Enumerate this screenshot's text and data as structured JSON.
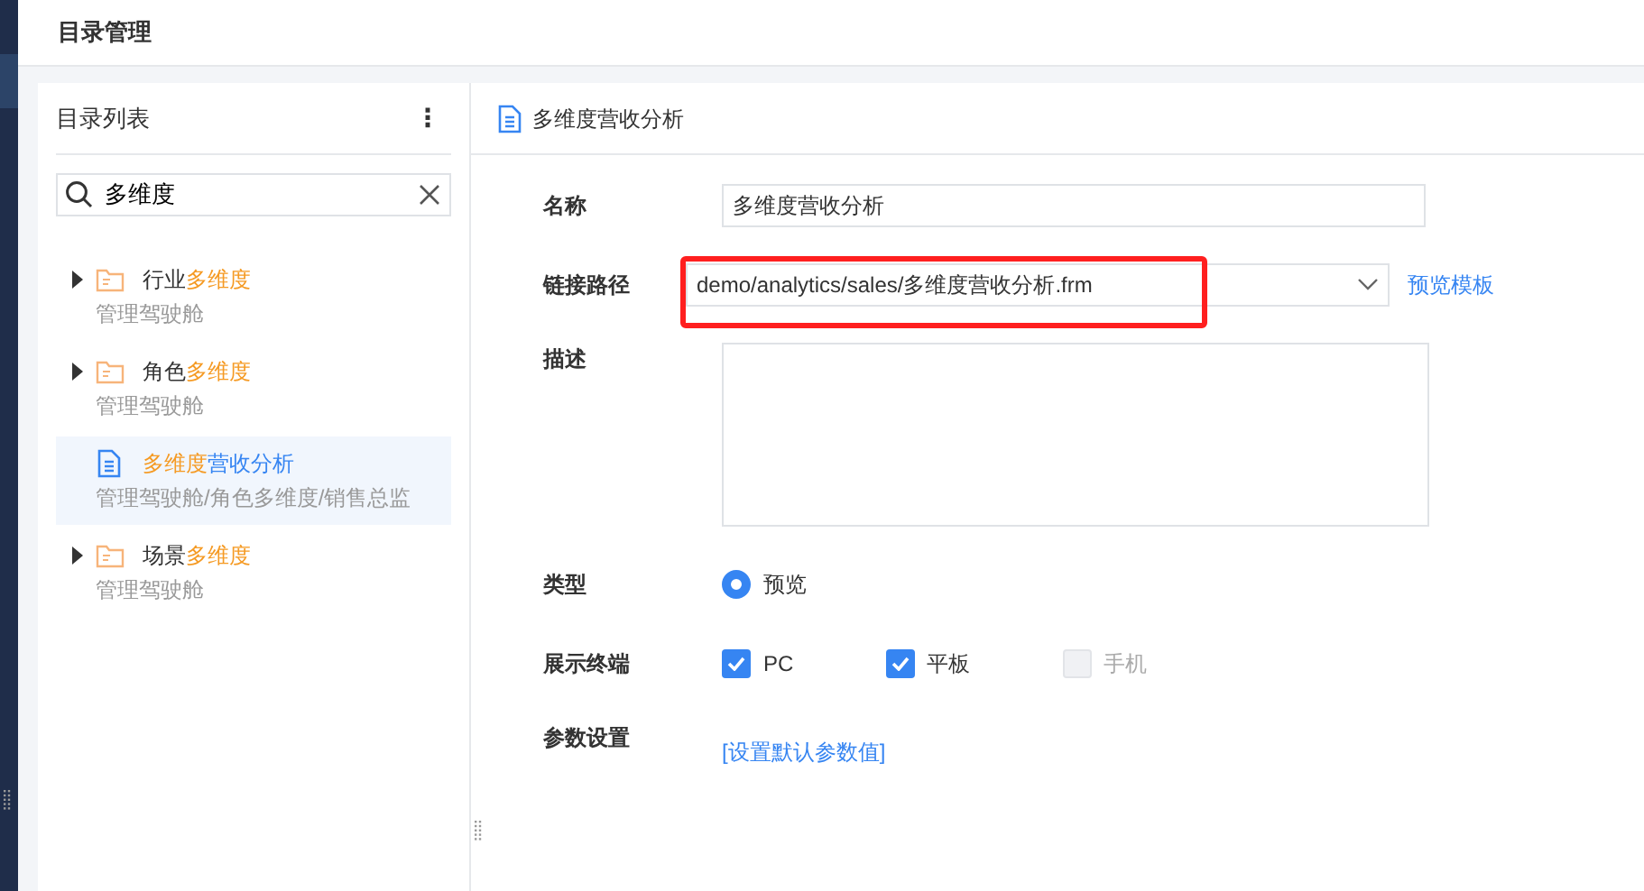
{
  "header": {
    "title": "目录管理"
  },
  "catalog": {
    "title": "目录列表",
    "menu_icon": "⋮",
    "search": {
      "value": "多维度"
    },
    "items": [
      {
        "kind": "folder",
        "expanded": false,
        "selected": false,
        "name": [
          {
            "text": "行业",
            "match": false
          },
          {
            "text": "多维度",
            "match": true
          }
        ],
        "path": "管理驾驶舱"
      },
      {
        "kind": "folder",
        "expanded": false,
        "selected": false,
        "name": [
          {
            "text": "角色",
            "match": false
          },
          {
            "text": "多维度",
            "match": true
          }
        ],
        "path": "管理驾驶舱"
      },
      {
        "kind": "file",
        "selected": true,
        "name": [
          {
            "text": "多维度",
            "match": true
          },
          {
            "text": "营收分析",
            "match": false
          }
        ],
        "path": "管理驾驶舱/角色多维度/销售总监"
      },
      {
        "kind": "folder",
        "expanded": false,
        "selected": false,
        "name": [
          {
            "text": "场景",
            "match": false
          },
          {
            "text": "多维度",
            "match": true
          }
        ],
        "path": "管理驾驶舱"
      }
    ]
  },
  "detail": {
    "title": "多维度营收分析",
    "name_field": {
      "label": "名称",
      "value": "多维度营收分析"
    },
    "path_field": {
      "label": "链接路径",
      "value": "demo/analytics/sales/多维度营收分析.frm",
      "highlighted": true,
      "link": "预览模板"
    },
    "description": {
      "label": "描述"
    },
    "type": {
      "label": "类型",
      "options": [
        {
          "label": "预览",
          "selected": true
        }
      ]
    },
    "terminals": {
      "label": "展示终端",
      "options": [
        {
          "label": "PC",
          "checked": true,
          "disabled": false
        },
        {
          "label": "平板",
          "checked": true,
          "disabled": false
        },
        {
          "label": "手机",
          "checked": false,
          "disabled": true
        }
      ]
    },
    "params": {
      "label": "参数设置",
      "link": "[设置默认参数值]"
    }
  }
}
